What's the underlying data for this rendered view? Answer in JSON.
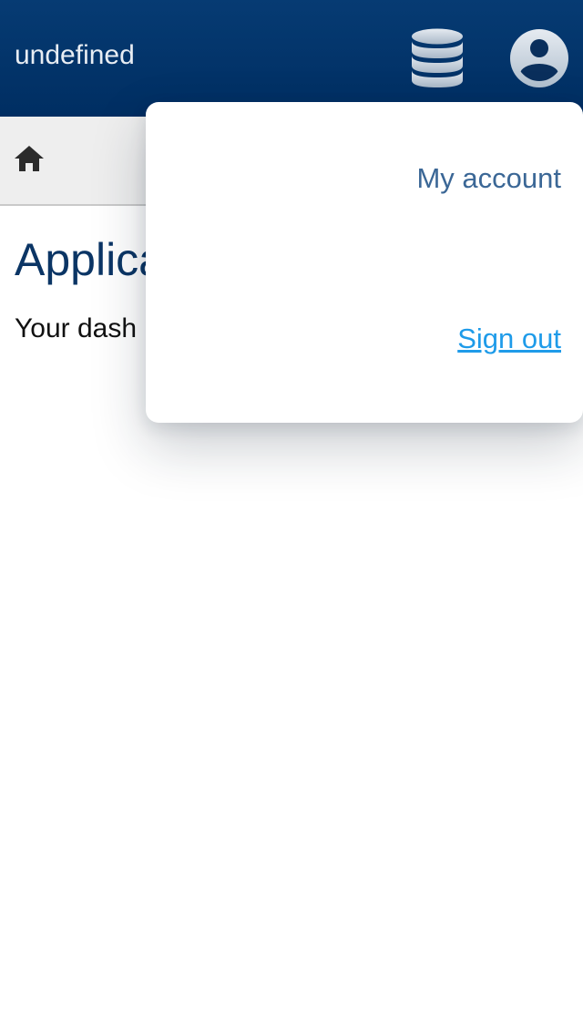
{
  "header": {
    "title": "undefined",
    "icons": {
      "database": "database-icon",
      "account": "account-circle-icon"
    }
  },
  "toolbar": {
    "home_icon": "home-icon"
  },
  "main": {
    "title": "Applica",
    "description": "Your dash"
  },
  "account_menu": {
    "my_account": "My account",
    "sign_out": "Sign out"
  },
  "colors": {
    "header_bg": "#003366",
    "title_text": "#0b3565",
    "menu_link": "#3b6796",
    "sign_out_link": "#1e9be9",
    "toolbar_bg": "#eeeeee"
  }
}
